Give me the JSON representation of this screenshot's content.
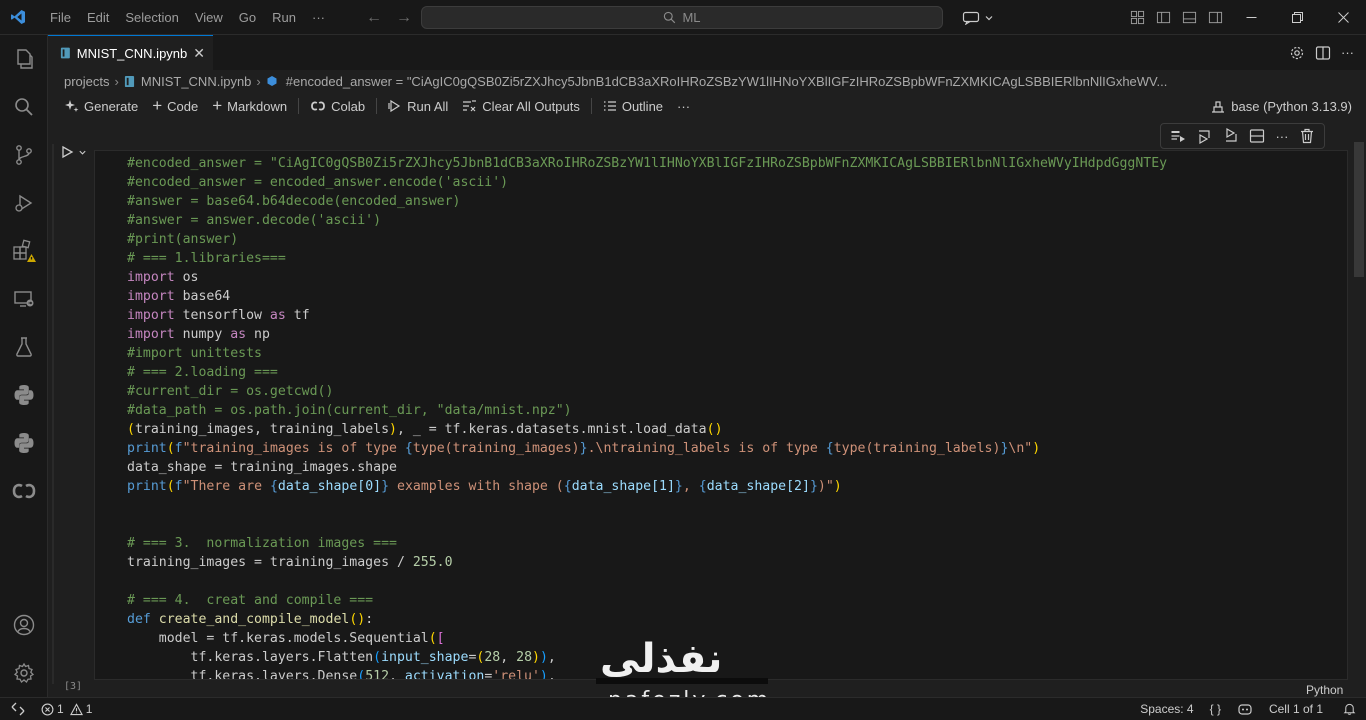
{
  "titlebar": {
    "menu": [
      "File",
      "Edit",
      "Selection",
      "View",
      "Go",
      "Run",
      "···"
    ],
    "search_text": "ML"
  },
  "tab": {
    "label": "MNIST_CNN.ipynb",
    "close": "✕"
  },
  "breadcrumb": {
    "folder": "projects",
    "file": "MNIST_CNN.ipynb",
    "symbol": "#encoded_answer = \"CiAgIC0gQSB0Zi5rZXJhcy5JbnB1dCB3aXRoIHRoZSBzYW1lIHNoYXBlIGFzIHRoZSBpbWFnZXMKICAgLSBBIERlbnNlIGxheWV..."
  },
  "toolbar": {
    "generate": "Generate",
    "code": "Code",
    "markdown": "Markdown",
    "colab": "Colab",
    "run_all": "Run All",
    "clear_outputs": "Clear All Outputs",
    "outline": "Outline",
    "more": "···",
    "kernel": "base (Python 3.13.9)"
  },
  "cell": {
    "execution_count": "[3]",
    "language": "Python"
  },
  "watermark": {
    "arabic": "نفذلي",
    "latin": "nafezly.com"
  },
  "statusbar": {
    "errors": "1",
    "warnings": "1",
    "spaces": "Spaces: 4",
    "braces": "{ }",
    "cell_position": "Cell 1 of 1"
  },
  "colors": {
    "accent": "#0078d4",
    "background": "#1f1f1f",
    "editor": "#181818",
    "comment": "#6a9955",
    "keyword": "#c586c0",
    "string": "#ce9178"
  },
  "code_lines": [
    [
      [
        "c-com",
        "#encoded_answer = \"CiAgIC0gQSB0Zi5rZXJhcy5JbnB1dCB3aXRoIHRoZSBzYW1lIHNoYXBlIGFzIHRoZSBpbWFnZXMKICAgLSBBIERlbnNlIGxheWVyIHdpdGggNTEy"
      ]
    ],
    [
      [
        "c-com",
        "#encoded_answer = encoded_answer.encode('ascii')"
      ]
    ],
    [
      [
        "c-com",
        "#answer = base64.b64decode(encoded_answer)"
      ]
    ],
    [
      [
        "c-com",
        "#answer = answer.decode('ascii')"
      ]
    ],
    [
      [
        "c-com",
        "#print(answer)"
      ]
    ],
    [
      [
        "c-com",
        "# === 1.libraries==="
      ]
    ],
    [
      [
        "c-kw",
        "import"
      ],
      [
        "",
        " os"
      ]
    ],
    [
      [
        "c-kw",
        "import"
      ],
      [
        "",
        " base64"
      ]
    ],
    [
      [
        "c-kw",
        "import"
      ],
      [
        "",
        " tensorflow "
      ],
      [
        "c-kw",
        "as"
      ],
      [
        "",
        " tf"
      ]
    ],
    [
      [
        "c-kw",
        "import"
      ],
      [
        "",
        " numpy "
      ],
      [
        "c-kw",
        "as"
      ],
      [
        "",
        " np"
      ]
    ],
    [
      [
        "c-com",
        "#import unittests"
      ]
    ],
    [
      [
        "c-com",
        "# === 2.loading ==="
      ]
    ],
    [
      [
        "c-com",
        "#current_dir = os.getcwd()"
      ]
    ],
    [
      [
        "c-com",
        "#data_path = os.path.join(current_dir, \"data/mnist.npz\")"
      ]
    ],
    [
      [
        "c-br",
        "("
      ],
      [
        "",
        "training_images, training_labels"
      ],
      [
        "c-br",
        ")"
      ],
      [
        "",
        ", _ = tf.keras.datasets.mnist.load_data"
      ],
      [
        "c-br",
        "()"
      ]
    ],
    [
      [
        "c-kw2",
        "print"
      ],
      [
        "c-br",
        "("
      ],
      [
        "c-kw2",
        "f"
      ],
      [
        "c-str",
        "\"training_images is of type "
      ],
      [
        "c-kw2",
        "{"
      ],
      [
        "c-str",
        "type(training_images)"
      ],
      [
        "c-kw2",
        "}"
      ],
      [
        "c-str",
        ".\\ntraining_labels is of type "
      ],
      [
        "c-kw2",
        "{"
      ],
      [
        "c-str",
        "type(training_labels)"
      ],
      [
        "c-kw2",
        "}"
      ],
      [
        "c-str",
        "\\n\""
      ],
      [
        "c-br",
        ")"
      ]
    ],
    [
      [
        "",
        "data_shape = training_images.shape"
      ]
    ],
    [
      [
        "c-kw2",
        "print"
      ],
      [
        "c-br",
        "("
      ],
      [
        "c-kw2",
        "f"
      ],
      [
        "c-str",
        "\"There are "
      ],
      [
        "c-kw2",
        "{"
      ],
      [
        "c-var",
        "data_shape[0]"
      ],
      [
        "c-kw2",
        "}"
      ],
      [
        "c-str",
        " examples with shape ("
      ],
      [
        "c-kw2",
        "{"
      ],
      [
        "c-var",
        "data_shape[1]"
      ],
      [
        "c-kw2",
        "}"
      ],
      [
        "c-str",
        ", "
      ],
      [
        "c-kw2",
        "{"
      ],
      [
        "c-var",
        "data_shape[2]"
      ],
      [
        "c-kw2",
        "}"
      ],
      [
        "c-str",
        ")\""
      ],
      [
        "c-br",
        ")"
      ]
    ],
    [
      [
        "",
        ""
      ]
    ],
    [
      [
        "",
        ""
      ]
    ],
    [
      [
        "c-com",
        "# === 3.  normalization images ==="
      ]
    ],
    [
      [
        "",
        "training_images = training_images / "
      ],
      [
        "c-num",
        "255.0"
      ]
    ],
    [
      [
        "",
        ""
      ]
    ],
    [
      [
        "c-com",
        "# === 4.  creat and compile ==="
      ]
    ],
    [
      [
        "c-kw2",
        "def"
      ],
      [
        "",
        " "
      ],
      [
        "c-fn",
        "create_and_compile_model"
      ],
      [
        "c-br",
        "()"
      ],
      [
        "",
        ":"
      ]
    ],
    [
      [
        "",
        "    model = tf.keras.models.Sequential"
      ],
      [
        "c-br",
        "("
      ],
      [
        "c-br2",
        "["
      ]
    ],
    [
      [
        "",
        "        tf.keras.layers.Flatten"
      ],
      [
        "c-br3",
        "("
      ],
      [
        "c-var",
        "input_shape"
      ],
      [
        "",
        "="
      ],
      [
        "c-br",
        "("
      ],
      [
        "c-num",
        "28"
      ],
      [
        "",
        ", "
      ],
      [
        "c-num",
        "28"
      ],
      [
        "c-br",
        ")"
      ],
      [
        "c-br3",
        ")"
      ],
      [
        "",
        ","
      ]
    ],
    [
      [
        "",
        "        tf.keras.layers.Dense"
      ],
      [
        "c-br3",
        "("
      ],
      [
        "c-num",
        "512"
      ],
      [
        "",
        ", "
      ],
      [
        "c-var",
        "activation"
      ],
      [
        "",
        "="
      ],
      [
        "c-str",
        "'relu'"
      ],
      [
        "c-br3",
        ")"
      ],
      [
        "",
        ","
      ]
    ]
  ]
}
